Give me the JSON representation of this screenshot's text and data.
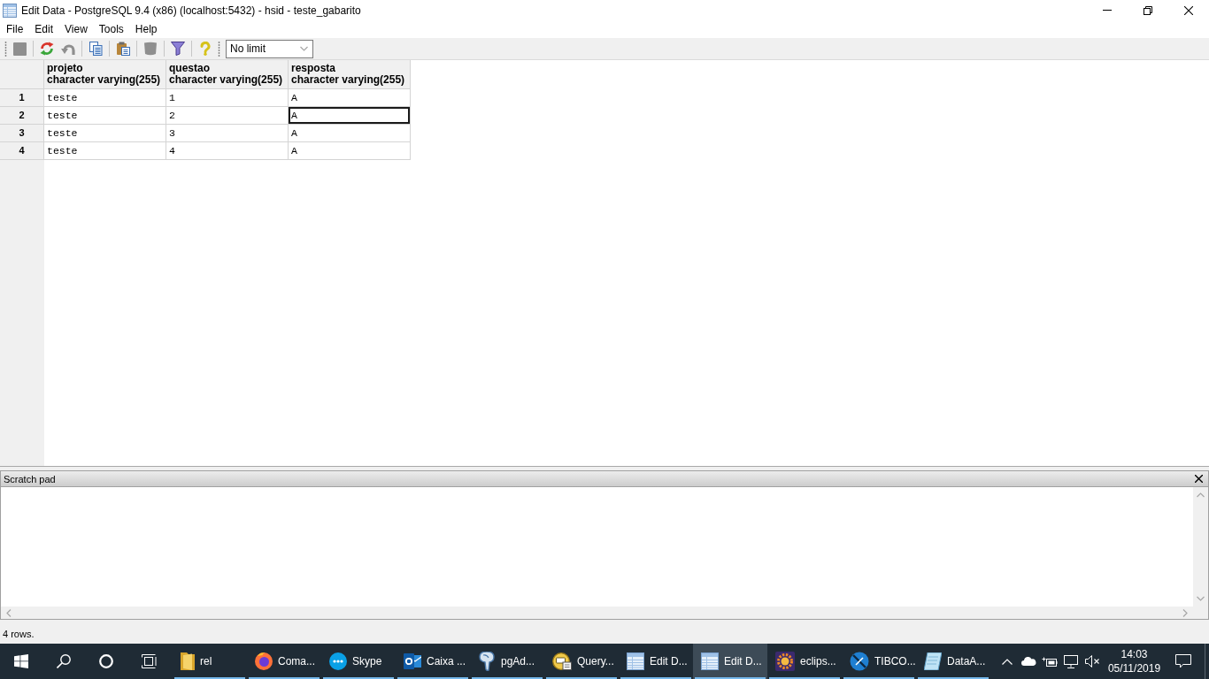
{
  "window": {
    "title": "Edit Data - PostgreSQL 9.4 (x86) (localhost:5432) - hsid - teste_gabarito"
  },
  "menu": [
    "File",
    "Edit",
    "View",
    "Tools",
    "Help"
  ],
  "toolbar": {
    "groups": [
      [
        {
          "kind": "save",
          "disabled": true
        }
      ],
      [
        {
          "kind": "refresh",
          "disabled": false
        },
        {
          "kind": "undo",
          "disabled": true
        }
      ],
      [
        {
          "kind": "copy",
          "disabled": false
        }
      ],
      [
        {
          "kind": "paste",
          "disabled": false
        }
      ],
      [
        {
          "kind": "delete",
          "disabled": true
        }
      ],
      [
        {
          "kind": "filter",
          "disabled": false
        }
      ],
      [
        {
          "kind": "help",
          "disabled": false
        }
      ]
    ],
    "row_limit": {
      "value": "No limit"
    }
  },
  "grid": {
    "columns": [
      {
        "name": "projeto",
        "type": "character varying(255)"
      },
      {
        "name": "questao",
        "type": "character varying(255)"
      },
      {
        "name": "resposta",
        "type": "character varying(255)"
      }
    ],
    "rows": [
      {
        "number": "1",
        "cells": [
          {
            "value": "teste",
            "selected": false
          },
          {
            "value": "1",
            "selected": false
          },
          {
            "value": "A",
            "selected": false
          }
        ]
      },
      {
        "number": "2",
        "cells": [
          {
            "value": "teste",
            "selected": false
          },
          {
            "value": "2",
            "selected": false
          },
          {
            "value": "A",
            "selected": true
          }
        ]
      },
      {
        "number": "3",
        "cells": [
          {
            "value": "teste",
            "selected": false
          },
          {
            "value": "3",
            "selected": false
          },
          {
            "value": "A",
            "selected": false
          }
        ]
      },
      {
        "number": "4",
        "cells": [
          {
            "value": "teste",
            "selected": false
          },
          {
            "value": "4",
            "selected": false
          },
          {
            "value": "A",
            "selected": false
          }
        ]
      }
    ]
  },
  "scratch_pad": {
    "title": "Scratch pad"
  },
  "status_bar": {
    "text": "4 rows."
  },
  "taskbar": {
    "apps": [
      {
        "kind": "folder",
        "label": "rel",
        "running": true,
        "selected": false
      },
      {
        "kind": "browser",
        "label": "Coma...",
        "running": true,
        "selected": false
      },
      {
        "kind": "messenger",
        "label": "Skype",
        "running": true,
        "selected": false
      },
      {
        "kind": "mail",
        "label": "Caixa ...",
        "running": true,
        "selected": false
      },
      {
        "kind": "database",
        "label": "pgAd...",
        "running": true,
        "selected": false
      },
      {
        "kind": "query",
        "label": "Query...",
        "running": true,
        "selected": false
      },
      {
        "kind": "table",
        "label": "Edit D...",
        "running": true,
        "selected": false
      },
      {
        "kind": "table",
        "label": "Edit D...",
        "running": true,
        "selected": true
      },
      {
        "kind": "ide",
        "label": "eclips...",
        "running": true,
        "selected": false
      },
      {
        "kind": "integration",
        "label": "TIBCO...",
        "running": true,
        "selected": false
      },
      {
        "kind": "notes",
        "label": "DataA...",
        "running": true,
        "selected": false
      }
    ],
    "volume_muted": true,
    "clock": {
      "time": "14:03",
      "date": "05/11/2019"
    }
  }
}
